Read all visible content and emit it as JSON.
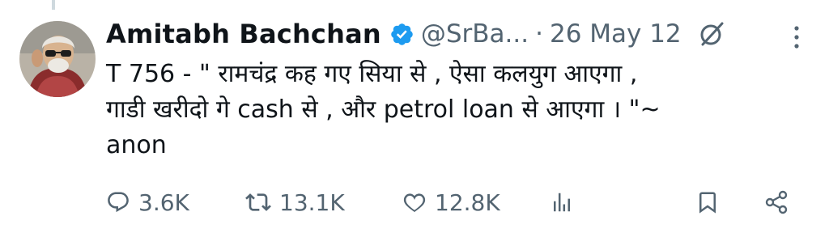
{
  "tweet": {
    "author_name": "Amitabh Bachchan",
    "handle": "@SrBa...",
    "separator": "·",
    "date": "26 May 12",
    "text": "T 756 - \" रामचंद्र कह गए सिया से , ऐसा कलयुग आएगा ,\nगाडी खरीदो गे cash से , और petrol loan से आएगा । \"~\nanon"
  },
  "actions": {
    "replies": "3.6K",
    "retweets": "13.1K",
    "likes": "12.8K"
  },
  "colors": {
    "text": "#0f1419",
    "secondary": "#536471",
    "verified": "#1d9bf0"
  },
  "icons": [
    "verified-badge-icon",
    "grok-icon",
    "more-options-icon",
    "reply-icon",
    "retweet-icon",
    "like-icon",
    "views-icon",
    "bookmark-icon",
    "share-icon"
  ]
}
